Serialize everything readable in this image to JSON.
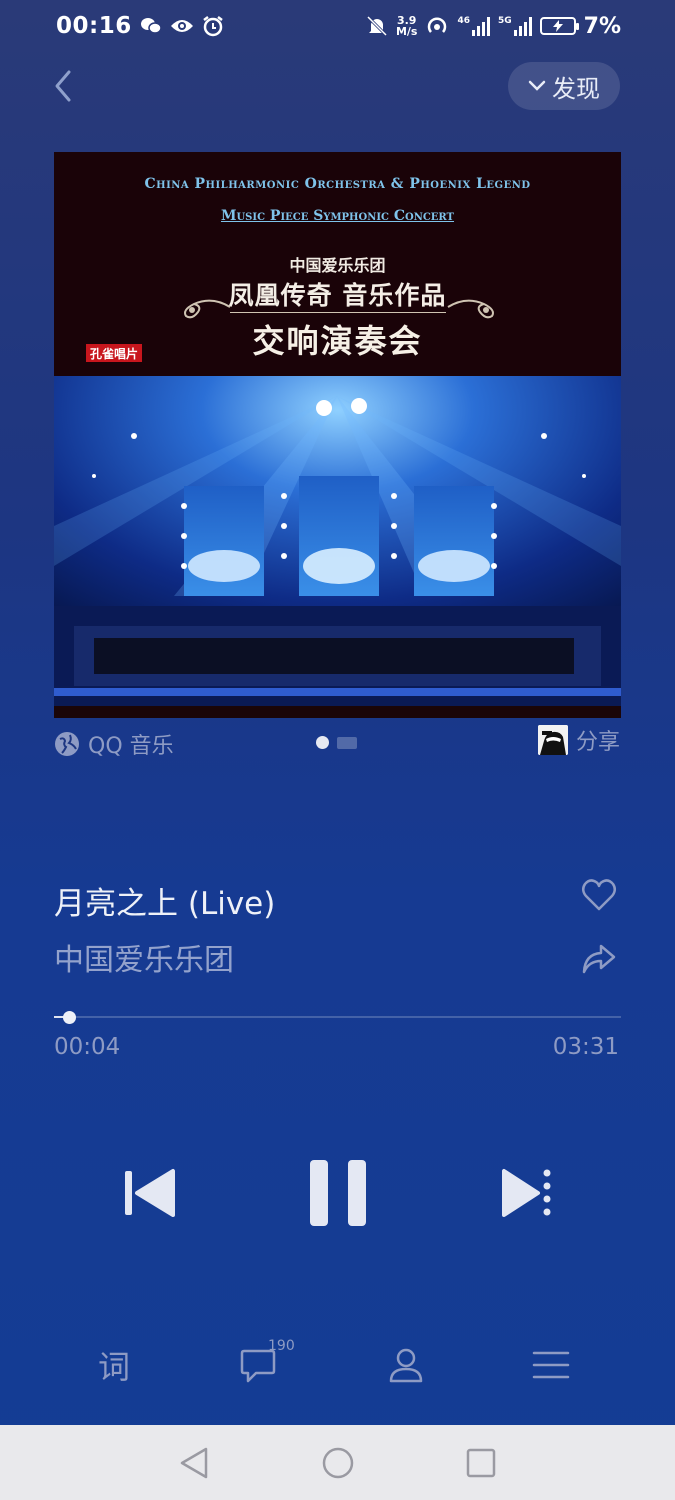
{
  "status_bar": {
    "time": "00:16",
    "net_speed_value": "3.9",
    "net_speed_unit": "M/s",
    "sig1_label": "46",
    "sig2_label": "5G",
    "battery_percent": "7%"
  },
  "header": {
    "discover_label": "发现"
  },
  "album": {
    "title_en_line1": "China Philharmonic Orchestra & Phoenix Legend",
    "title_en_line2": "Music Piece Symphonic Concert",
    "title_cn_line1": "中国爱乐乐团",
    "title_cn_line2": "凤凰传奇 音乐作品",
    "title_cn_line3": "交响演奏会",
    "label_logo": "孔雀唱片"
  },
  "source": {
    "label": "QQ 音乐"
  },
  "share": {
    "label": "分享"
  },
  "song": {
    "title": "月亮之上 (Live)",
    "artist": "中国爱乐乐团"
  },
  "progress": {
    "current": "00:04",
    "total": "03:31",
    "fraction": 0.019
  },
  "bottom_bar": {
    "lyrics_label": "词",
    "comment_count": "190"
  },
  "colors": {
    "background_top": "#2a3a78",
    "background_bottom": "#143d94",
    "text_secondary": "#8e9bc4",
    "nav_bar": "#e9e9ec"
  }
}
